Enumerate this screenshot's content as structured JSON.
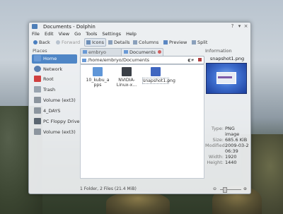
{
  "window": {
    "title": "Documents - Dolphin"
  },
  "menu": [
    "File",
    "Edit",
    "View",
    "Go",
    "Tools",
    "Settings",
    "Help"
  ],
  "toolbar": {
    "back": "Back",
    "forward": "Forward",
    "icons": "Icons",
    "details": "Details",
    "columns": "Columns",
    "preview": "Preview",
    "split": "Split"
  },
  "places": {
    "title": "Places",
    "items": [
      "Home",
      "Network",
      "Root",
      "Trash",
      "Volume (ext3)",
      "4_DAYS",
      "PC Floppy Drive",
      "Volume (ext3)"
    ]
  },
  "tabs": {
    "first": "embryo",
    "second": "Documents"
  },
  "address": {
    "path": "/home/embryo/Documents"
  },
  "files": [
    {
      "name": "10_kubu_a pps",
      "type": "folder"
    },
    {
      "name": "NVIDIA-Linux-x...",
      "type": "script"
    },
    {
      "name": "snapshot1.png",
      "type": "image"
    }
  ],
  "info": {
    "title": "Information",
    "filename": "snapshot1.png",
    "labels": {
      "type": "Type:",
      "size": "Size:",
      "modified": "Modified:",
      "width": "Width:",
      "height": "Height:"
    },
    "values": {
      "type_line1": "PNG",
      "type_line2": "image",
      "size": "685.6 KiB",
      "modified_line1": "2009-03-2",
      "modified_line2": "06:39",
      "width": "1920",
      "height": "1440"
    }
  },
  "status": {
    "text": "1 Folder, 2 Files (21.4 MiB)"
  }
}
